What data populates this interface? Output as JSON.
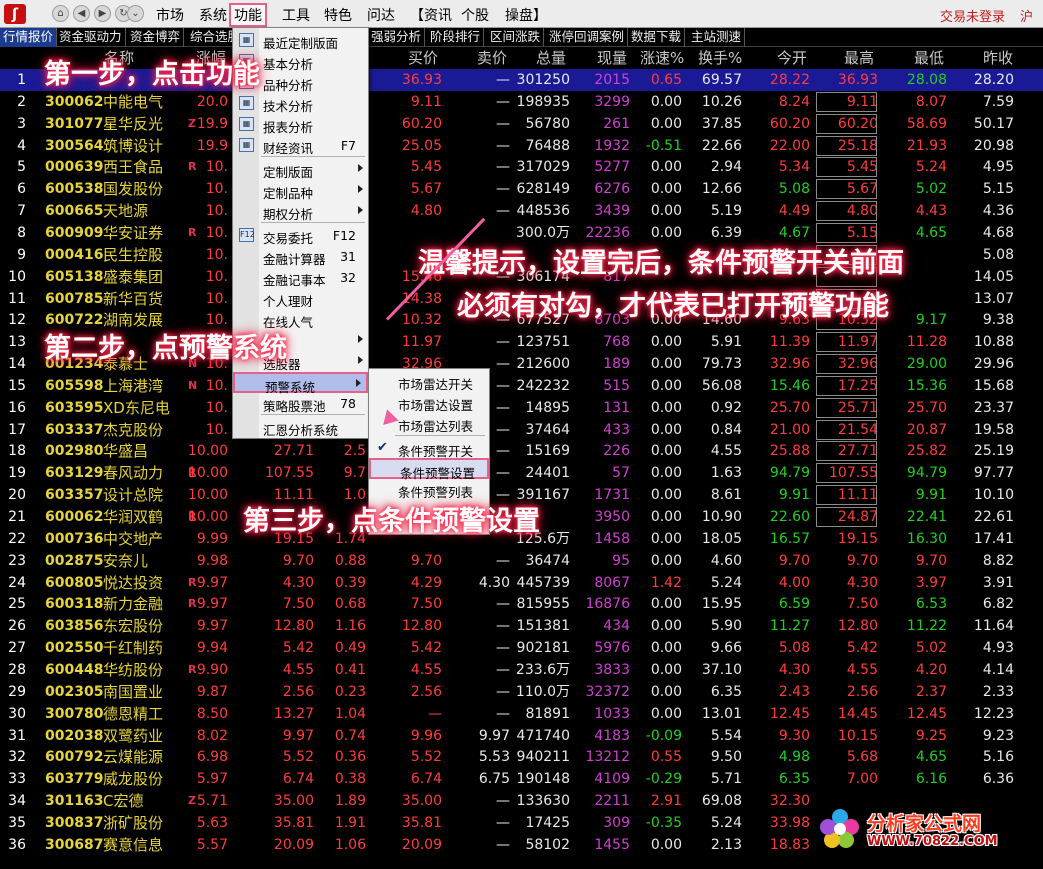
{
  "menubar": {
    "items": [
      "市场",
      "系统",
      "功能",
      "工具",
      "特色",
      "问达",
      "【资讯",
      "个股",
      "操盘】"
    ],
    "login": "交易未登录",
    "login_tail": "沪"
  },
  "tabs": [
    "行情报价",
    "资金驱动力",
    "资金博弈",
    "综合选股",
    "",
    "",
    "",
    "强弱分析",
    "阶段排行",
    "区间涨跌",
    "涨停回调案例",
    "数据下载",
    "主站测速"
  ],
  "header": {
    "buy": "买价",
    "sell": "卖价",
    "vol": "总量",
    "cur": "现量",
    "speed": "涨速%",
    "turnover": "换手%",
    "open": "今开",
    "high": "最高",
    "low": "最低",
    "prev": "昨收",
    "pct": "涨幅",
    "name": "名称"
  },
  "rows": [
    {
      "i": "1",
      "code": "",
      "name": "",
      "flag": "",
      "pct": "",
      "price": "",
      "chg": "",
      "buy": "36.93",
      "sell": "—",
      "vol": "301250",
      "cur": "2015",
      "spd": "0.65",
      "turn": "69.57",
      "open": "28.22",
      "high": "36.93",
      "low": "28.08",
      "prev": "28.20"
    },
    {
      "i": "2",
      "code": "300062",
      "name": "中能电气",
      "flag": "",
      "pct": "20.0",
      "price": "",
      "chg": "",
      "buy": "9.11",
      "sell": "—",
      "vol": "198935",
      "cur": "3299",
      "spd": "0.00",
      "turn": "10.26",
      "open": "8.24",
      "high": "9.11",
      "low": "8.07",
      "prev": "7.59"
    },
    {
      "i": "3",
      "code": "301077",
      "name": "星华反光",
      "flag": "Z",
      "pct": "19.9",
      "price": "",
      "chg": "",
      "buy": "60.20",
      "sell": "—",
      "vol": "56780",
      "cur": "261",
      "spd": "0.00",
      "turn": "37.85",
      "open": "60.20",
      "high": "60.20",
      "low": "58.69",
      "prev": "50.17"
    },
    {
      "i": "4",
      "code": "300564",
      "name": "筑博设计",
      "flag": "",
      "pct": "19.9",
      "price": "",
      "chg": "",
      "buy": "25.05",
      "sell": "—",
      "vol": "76488",
      "cur": "1932",
      "spd": "-0.51",
      "turn": "22.66",
      "open": "22.00",
      "high": "25.18",
      "low": "21.93",
      "prev": "20.98"
    },
    {
      "i": "5",
      "code": "000639",
      "name": "西王食品",
      "flag": "R",
      "pct": "10.",
      "price": "",
      "chg": "",
      "buy": "5.45",
      "sell": "—",
      "vol": "317029",
      "cur": "5277",
      "spd": "0.00",
      "turn": "2.94",
      "open": "5.34",
      "high": "5.45",
      "low": "5.24",
      "prev": "4.95"
    },
    {
      "i": "6",
      "code": "600538",
      "name": "国发股份",
      "flag": "",
      "pct": "10.",
      "price": "",
      "chg": "",
      "buy": "5.67",
      "sell": "—",
      "vol": "628149",
      "cur": "6276",
      "spd": "0.00",
      "turn": "12.66",
      "open": "5.08",
      "high": "5.67",
      "low": "5.02",
      "prev": "5.15"
    },
    {
      "i": "7",
      "code": "600665",
      "name": "天地源",
      "flag": "",
      "pct": "10.",
      "price": "",
      "chg": "",
      "buy": "4.80",
      "sell": "—",
      "vol": "448536",
      "cur": "3439",
      "spd": "0.00",
      "turn": "5.19",
      "open": "4.49",
      "high": "4.80",
      "low": "4.43",
      "prev": "4.36"
    },
    {
      "i": "8",
      "code": "600909",
      "name": "华安证券",
      "flag": "R",
      "pct": "10.",
      "price": "",
      "chg": "",
      "buy": "",
      "sell": "",
      "vol": "300.0万",
      "cur": "22236",
      "spd": "0.00",
      "turn": "6.39",
      "open": "4.67",
      "high": "5.15",
      "low": "4.65",
      "prev": "4.68"
    },
    {
      "i": "9",
      "code": "000416",
      "name": "民生控股",
      "flag": "",
      "pct": "10.",
      "price": "",
      "chg": "",
      "buy": "",
      "sell": "",
      "vol": "",
      "cur": "",
      "spd": "",
      "turn": "",
      "open": "",
      "high": "",
      "low": "",
      "prev": "5.08"
    },
    {
      "i": "10",
      "code": "605138",
      "name": "盛泰集团",
      "flag": "",
      "pct": "10.",
      "price": "",
      "chg": "",
      "buy": "15.46",
      "sell": "—",
      "vol": "306174",
      "cur": "817",
      "spd": "",
      "turn": "",
      "open": "",
      "high": "",
      "low": "",
      "prev": "14.05"
    },
    {
      "i": "11",
      "code": "600785",
      "name": "新华百货",
      "flag": "",
      "pct": "10.",
      "price": "",
      "chg": "",
      "buy": "14.38",
      "sell": "—",
      "vol": "",
      "cur": "",
      "spd": "",
      "turn": "",
      "open": "",
      "high": "",
      "low": "",
      "prev": "13.07"
    },
    {
      "i": "12",
      "code": "600722",
      "name": "湖南发展",
      "flag": "",
      "pct": "10.",
      "price": "",
      "chg": "",
      "buy": "10.32",
      "sell": "—",
      "vol": "677527",
      "cur": "8703",
      "spd": "0.00",
      "turn": "14.60",
      "open": "9.63",
      "high": "10.32",
      "low": "9.17",
      "prev": "9.38"
    },
    {
      "i": "13",
      "code": "",
      "name": "",
      "flag": "",
      "pct": "",
      "price": "",
      "chg": "",
      "buy": "11.97",
      "sell": "—",
      "vol": "123751",
      "cur": "768",
      "spd": "0.00",
      "turn": "5.91",
      "open": "11.39",
      "high": "11.97",
      "low": "11.28",
      "prev": "10.88"
    },
    {
      "i": "14",
      "code": "001234",
      "name": "泰慕士",
      "flag": "N",
      "pct": "10.",
      "price": "",
      "chg": "",
      "buy": "32.96",
      "sell": "—",
      "vol": "212600",
      "cur": "189",
      "spd": "0.00",
      "turn": "79.73",
      "open": "32.96",
      "high": "32.96",
      "low": "29.00",
      "prev": "29.96"
    },
    {
      "i": "15",
      "code": "605598",
      "name": "上海港湾",
      "flag": "N",
      "pct": "10.",
      "price": "",
      "chg": "",
      "buy": "",
      "sell": "—",
      "vol": "242232",
      "cur": "515",
      "spd": "0.00",
      "turn": "56.08",
      "open": "15.46",
      "high": "17.25",
      "low": "15.36",
      "prev": "15.68"
    },
    {
      "i": "16",
      "code": "603595",
      "name": "XD东尼电",
      "flag": "",
      "pct": "10.",
      "price": "",
      "chg": "",
      "buy": "",
      "sell": "—",
      "vol": "14895",
      "cur": "131",
      "spd": "0.00",
      "turn": "0.92",
      "open": "25.70",
      "high": "25.71",
      "low": "25.70",
      "prev": "23.37"
    },
    {
      "i": "17",
      "code": "603337",
      "name": "杰克股份",
      "flag": "",
      "pct": "10.",
      "price": "",
      "chg": "",
      "buy": "",
      "sell": "—",
      "vol": "37464",
      "cur": "433",
      "spd": "0.00",
      "turn": "0.84",
      "open": "21.00",
      "high": "21.54",
      "low": "20.87",
      "prev": "19.58"
    },
    {
      "i": "18",
      "code": "002980",
      "name": "华盛昌",
      "flag": "",
      "pct": "10.00",
      "price": "27.71",
      "chg": "2.5",
      "buy": "",
      "sell": "—",
      "vol": "15169",
      "cur": "226",
      "spd": "0.00",
      "turn": "4.55",
      "open": "25.88",
      "high": "27.71",
      "low": "25.82",
      "prev": "25.19"
    },
    {
      "i": "19",
      "code": "603129",
      "name": "春风动力",
      "flag": "R",
      "pct": "10.00",
      "price": "107.55",
      "chg": "9.7",
      "buy": "",
      "sell": "—",
      "vol": "24401",
      "cur": "57",
      "spd": "0.00",
      "turn": "1.63",
      "open": "94.79",
      "high": "107.55",
      "low": "94.79",
      "prev": "97.77"
    },
    {
      "i": "20",
      "code": "603357",
      "name": "设计总院",
      "flag": "",
      "pct": "10.00",
      "price": "11.11",
      "chg": "1.0",
      "buy": "",
      "sell": "—",
      "vol": "391167",
      "cur": "1731",
      "spd": "0.00",
      "turn": "8.61",
      "open": "9.91",
      "high": "11.11",
      "low": "9.91",
      "prev": "10.10"
    },
    {
      "i": "21",
      "code": "600062",
      "name": "华润双鹤",
      "flag": "R",
      "pct": "10.00",
      "price": "",
      "chg": "",
      "buy": "",
      "sell": "—",
      "vol": "",
      "cur": "3950",
      "spd": "0.00",
      "turn": "10.90",
      "open": "22.60",
      "high": "24.87",
      "low": "22.41",
      "prev": "22.61"
    },
    {
      "i": "22",
      "code": "000736",
      "name": "中交地产",
      "flag": "",
      "pct": "9.99",
      "price": "19.15",
      "chg": "1.74",
      "buy": "",
      "sell": "",
      "vol": "125.6万",
      "cur": "1458",
      "spd": "0.00",
      "turn": "18.05",
      "open": "16.57",
      "high": "19.15",
      "low": "16.30",
      "prev": "17.41"
    },
    {
      "i": "23",
      "code": "002875",
      "name": "安奈儿",
      "flag": "",
      "pct": "9.98",
      "price": "9.70",
      "chg": "0.88",
      "buy": "9.70",
      "sell": "—",
      "vol": "36474",
      "cur": "95",
      "spd": "0.00",
      "turn": "4.60",
      "open": "9.70",
      "high": "9.70",
      "low": "9.70",
      "prev": "8.82"
    },
    {
      "i": "24",
      "code": "600805",
      "name": "悦达投资",
      "flag": "R",
      "pct": "9.97",
      "price": "4.30",
      "chg": "0.39",
      "buy": "4.29",
      "sell": "4.30",
      "vol": "445739",
      "cur": "8067",
      "spd": "1.42",
      "turn": "5.24",
      "open": "4.00",
      "high": "4.30",
      "low": "3.97",
      "prev": "3.91"
    },
    {
      "i": "25",
      "code": "600318",
      "name": "新力金融",
      "flag": "R",
      "pct": "9.97",
      "price": "7.50",
      "chg": "0.68",
      "buy": "7.50",
      "sell": "—",
      "vol": "815955",
      "cur": "16876",
      "spd": "0.00",
      "turn": "15.95",
      "open": "6.59",
      "high": "7.50",
      "low": "6.53",
      "prev": "6.82"
    },
    {
      "i": "26",
      "code": "603856",
      "name": "东宏股份",
      "flag": "",
      "pct": "9.97",
      "price": "12.80",
      "chg": "1.16",
      "buy": "12.80",
      "sell": "—",
      "vol": "151381",
      "cur": "434",
      "spd": "0.00",
      "turn": "5.90",
      "open": "11.27",
      "high": "12.80",
      "low": "11.22",
      "prev": "11.64"
    },
    {
      "i": "27",
      "code": "002550",
      "name": "千红制药",
      "flag": "",
      "pct": "9.94",
      "price": "5.42",
      "chg": "0.49",
      "buy": "5.42",
      "sell": "—",
      "vol": "902181",
      "cur": "5976",
      "spd": "0.00",
      "turn": "9.66",
      "open": "5.08",
      "high": "5.42",
      "low": "5.02",
      "prev": "4.93"
    },
    {
      "i": "28",
      "code": "600448",
      "name": "华纺股份",
      "flag": "R",
      "pct": "9.90",
      "price": "4.55",
      "chg": "0.41",
      "buy": "4.55",
      "sell": "—",
      "vol": "233.6万",
      "cur": "3833",
      "spd": "0.00",
      "turn": "37.10",
      "open": "4.30",
      "high": "4.55",
      "low": "4.20",
      "prev": "4.14"
    },
    {
      "i": "29",
      "code": "002305",
      "name": "南国置业",
      "flag": "",
      "pct": "9.87",
      "price": "2.56",
      "chg": "0.23",
      "buy": "2.56",
      "sell": "—",
      "vol": "110.0万",
      "cur": "32372",
      "spd": "0.00",
      "turn": "6.35",
      "open": "2.43",
      "high": "2.56",
      "low": "2.37",
      "prev": "2.33"
    },
    {
      "i": "30",
      "code": "300780",
      "name": "德恩精工",
      "flag": "",
      "pct": "8.50",
      "price": "13.27",
      "chg": "1.04",
      "buy": "—",
      "sell": "—",
      "vol": "81891",
      "cur": "1033",
      "spd": "0.00",
      "turn": "13.01",
      "open": "12.45",
      "high": "14.45",
      "low": "12.45",
      "prev": "12.23"
    },
    {
      "i": "31",
      "code": "002038",
      "name": "双鹭药业",
      "flag": "",
      "pct": "8.02",
      "price": "9.97",
      "chg": "0.74",
      "buy": "9.96",
      "sell": "9.97",
      "vol": "471740",
      "cur": "4183",
      "spd": "-0.09",
      "turn": "5.54",
      "open": "9.30",
      "high": "10.15",
      "low": "9.25",
      "prev": "9.23"
    },
    {
      "i": "32",
      "code": "600792",
      "name": "云煤能源",
      "flag": "",
      "pct": "6.98",
      "price": "5.52",
      "chg": "0.36",
      "buy": "5.52",
      "sell": "5.53",
      "vol": "940211",
      "cur": "13212",
      "spd": "0.55",
      "turn": "9.50",
      "open": "4.98",
      "high": "5.68",
      "low": "4.65",
      "prev": "5.16"
    },
    {
      "i": "33",
      "code": "603779",
      "name": "威龙股份",
      "flag": "",
      "pct": "5.97",
      "price": "6.74",
      "chg": "0.38",
      "buy": "6.74",
      "sell": "6.75",
      "vol": "190148",
      "cur": "4109",
      "spd": "-0.29",
      "turn": "5.71",
      "open": "6.35",
      "high": "7.00",
      "low": "6.16",
      "prev": "6.36"
    },
    {
      "i": "34",
      "code": "301163",
      "name": "C宏德",
      "flag": "Z",
      "pct": "5.71",
      "price": "35.00",
      "chg": "1.89",
      "buy": "35.00",
      "sell": "—",
      "vol": "133630",
      "cur": "2211",
      "spd": "2.91",
      "turn": "69.08",
      "open": "32.30",
      "high": "",
      "low": "",
      "prev": ""
    },
    {
      "i": "35",
      "code": "300837",
      "name": "浙矿股份",
      "flag": "",
      "pct": "5.63",
      "price": "35.81",
      "chg": "1.91",
      "buy": "35.81",
      "sell": "—",
      "vol": "17425",
      "cur": "309",
      "spd": "-0.35",
      "turn": "5.24",
      "open": "33.98",
      "high": "",
      "low": "",
      "prev": ""
    },
    {
      "i": "36",
      "code": "300687",
      "name": "赛意信息",
      "flag": "",
      "pct": "5.57",
      "price": "20.09",
      "chg": "1.06",
      "buy": "20.09",
      "sell": "—",
      "vol": "58102",
      "cur": "1455",
      "spd": "0.00",
      "turn": "2.13",
      "open": "18.83",
      "high": "",
      "low": "",
      "prev": ""
    }
  ],
  "dropdown": {
    "items": [
      {
        "label": "最近定制版面",
        "sc": "",
        "arrow": false,
        "icon": "layout-icon"
      },
      {
        "label": "基本分析",
        "sc": "",
        "arrow": false,
        "icon": "chart-icon"
      },
      {
        "label": "品种分析",
        "sc": "",
        "arrow": false,
        "icon": "chart-icon"
      },
      {
        "label": "技术分析",
        "sc": "",
        "arrow": false,
        "icon": "candle-icon"
      },
      {
        "label": "报表分析",
        "sc": "",
        "arrow": false,
        "icon": "table-icon"
      },
      {
        "label": "财经资讯",
        "sc": "F7",
        "arrow": false,
        "icon": "news-icon"
      },
      {
        "label": "定制版面",
        "sc": "",
        "arrow": true,
        "icon": ""
      },
      {
        "label": "定制品种",
        "sc": "",
        "arrow": true,
        "icon": ""
      },
      {
        "label": "期权分析",
        "sc": "",
        "arrow": true,
        "icon": ""
      },
      {
        "label": "交易委托",
        "sc": "F12",
        "arrow": false,
        "icon": "trade-icon"
      },
      {
        "label": "金融计算器",
        "sc": "31",
        "arrow": false,
        "icon": ""
      },
      {
        "label": "金融记事本",
        "sc": "32",
        "arrow": false,
        "icon": ""
      },
      {
        "label": "个人理财",
        "sc": "",
        "arrow": false,
        "icon": ""
      },
      {
        "label": "在线人气",
        "sc": "",
        "arrow": false,
        "icon": ""
      },
      {
        "label": "",
        "sc": "",
        "arrow": true,
        "icon": ""
      },
      {
        "label": "选股器",
        "sc": "",
        "arrow": true,
        "icon": ""
      },
      {
        "label": "预警系统",
        "sc": "",
        "arrow": true,
        "icon": ""
      },
      {
        "label": "策略股票池",
        "sc": "78",
        "arrow": false,
        "icon": ""
      },
      {
        "label": "汇恩分析系统",
        "sc": "",
        "arrow": false,
        "icon": ""
      }
    ]
  },
  "submenu": {
    "items": [
      "市场雷达开关",
      "市场雷达设置",
      "市场雷达列表",
      "条件预警开关",
      "条件预警设置",
      "条件预警列表"
    ]
  },
  "annotations": {
    "step1": "第一步，点击功能",
    "step2": "第二步，点预警系统",
    "step3": "第三步，点条件预警设置",
    "tip1": "温馨提示，设置完后，条件预警开关前面",
    "tip2": "必须有对勾，才代表已打开预警功能"
  },
  "watermark": {
    "title": "分析家公式网",
    "url": "WWW.70822.COM"
  },
  "colors": {
    "up": "#ff3c3c",
    "down": "#20d020",
    "code": "#e6d43a",
    "volume": "#d040d0",
    "selected_row": "#1a1a96",
    "annotation_glow": "#ff2a4a"
  }
}
